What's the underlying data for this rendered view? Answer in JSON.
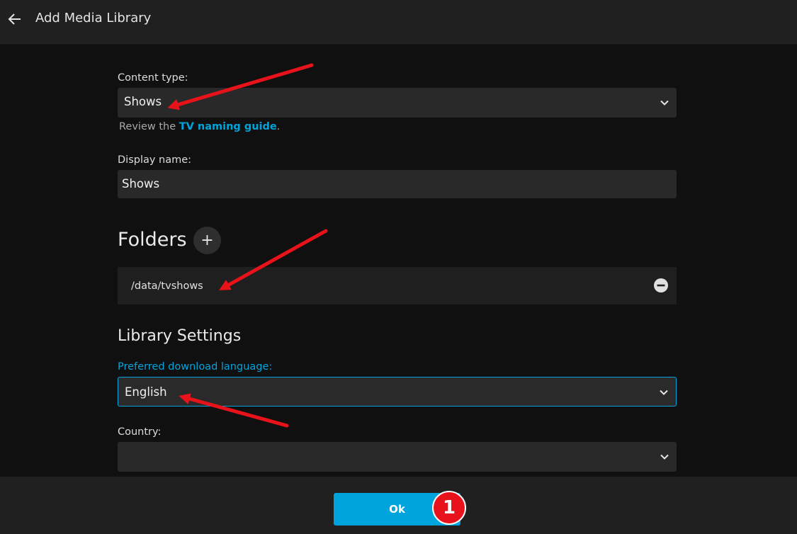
{
  "header": {
    "title": "Add Media Library",
    "back_icon": "arrow-left-icon"
  },
  "content_type": {
    "label": "Content type:",
    "value": "Shows"
  },
  "help": {
    "prefix": "Review the ",
    "link": "TV naming guide",
    "suffix": "."
  },
  "display_name": {
    "label": "Display name:",
    "value": "Shows"
  },
  "folders": {
    "title": "Folders",
    "add_label": "+",
    "items": [
      {
        "path": "/data/tvshows"
      }
    ]
  },
  "library_settings": {
    "title": "Library Settings",
    "language": {
      "label": "Preferred download language:",
      "value": "English"
    },
    "country": {
      "label": "Country:",
      "value": ""
    }
  },
  "footer": {
    "ok_label": "Ok",
    "step_badge": "1"
  },
  "colors": {
    "accent": "#00a4dc",
    "annotation": "#e8121a",
    "background": "#101010"
  }
}
